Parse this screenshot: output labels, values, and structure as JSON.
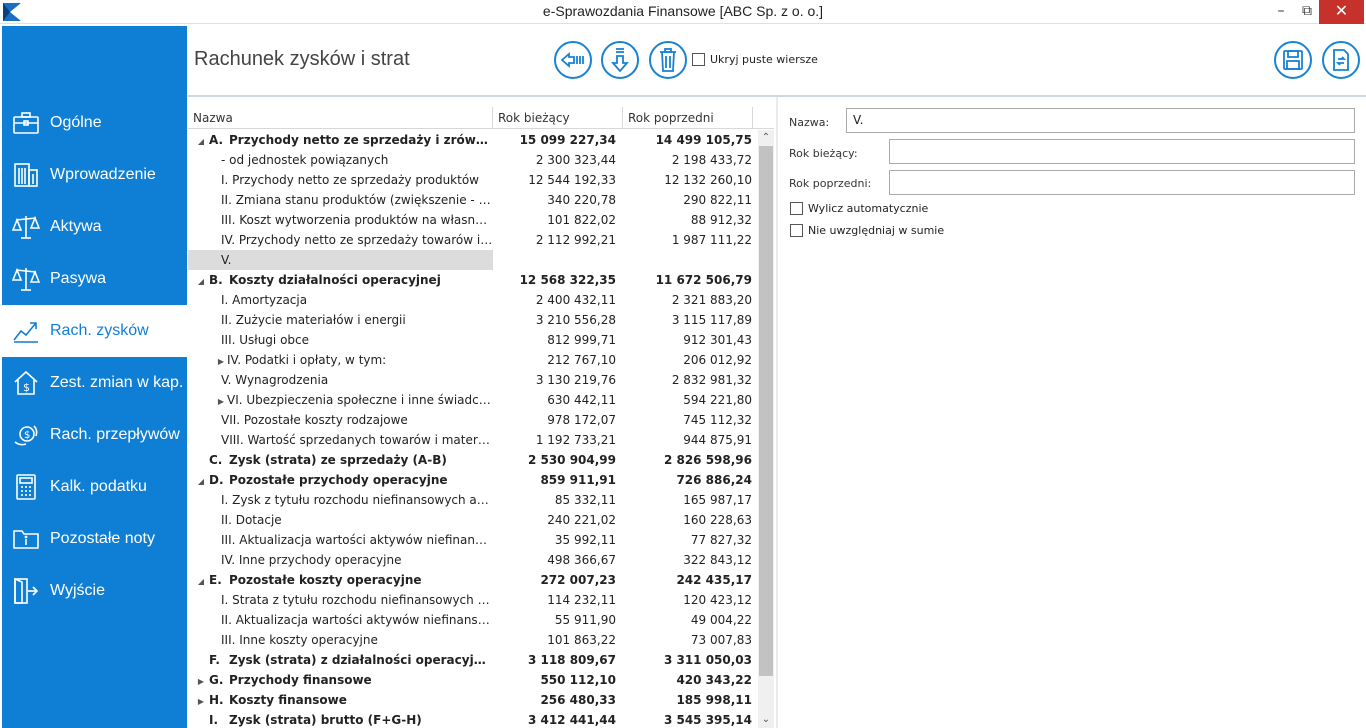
{
  "window": {
    "title": "e-Sprawozdania Finansowe  [ABC Sp. z o. o.]",
    "min": "–",
    "max": "⧉",
    "close": "✕"
  },
  "sidebar": {
    "items": [
      {
        "label": "Ogólne",
        "icon": "briefcase-icon"
      },
      {
        "label": "Wprowadzenie",
        "icon": "building-icon"
      },
      {
        "label": "Aktywa",
        "icon": "scales-icon"
      },
      {
        "label": "Pasywa",
        "icon": "scales-icon"
      },
      {
        "label": "Rach. zysków",
        "icon": "chart-trend-icon"
      },
      {
        "label": "Zest. zmian w kap.",
        "icon": "house-dollar-icon"
      },
      {
        "label": "Rach. przepływów",
        "icon": "cash-flow-icon"
      },
      {
        "label": "Kalk. podatku",
        "icon": "calculator-icon"
      },
      {
        "label": "Pozostałe noty",
        "icon": "folder-info-icon"
      },
      {
        "label": "Wyjście",
        "icon": "exit-door-icon"
      }
    ],
    "active_index": 4
  },
  "header": {
    "title": "Rachunek zysków i strat",
    "hide_empty_label": "Ukryj puste wiersze"
  },
  "grid": {
    "columns": [
      "Nazwa",
      "Rok bieżący",
      "Rok poprzedni"
    ],
    "rows": [
      {
        "indent": 0,
        "expander": "open",
        "letter": "A.",
        "name": "Przychody netto ze sprzedaży i zrównane z...",
        "cur": "15 099 227,34",
        "prev": "14 499 105,75",
        "bold": true
      },
      {
        "indent": 2,
        "expander": "",
        "letter": "",
        "name": "- od jednostek powiązanych",
        "cur": "2 300 323,44",
        "prev": "2 198 433,72",
        "bold": false
      },
      {
        "indent": 2,
        "expander": "",
        "letter": "",
        "name": "I. Przychody netto ze sprzedaży produktów",
        "cur": "12 544 192,33",
        "prev": "12 132 260,10",
        "bold": false
      },
      {
        "indent": 2,
        "expander": "",
        "letter": "",
        "name": "II. Zmiana stanu produktów (zwiększenie - war...",
        "cur": "340 220,78",
        "prev": "290 822,11",
        "bold": false
      },
      {
        "indent": 2,
        "expander": "",
        "letter": "",
        "name": "III. Koszt wytworzenia produktów na własne p...",
        "cur": "101 822,02",
        "prev": "88 912,32",
        "bold": false
      },
      {
        "indent": 2,
        "expander": "",
        "letter": "",
        "name": "IV. Przychody netto ze sprzedaży towarów i m...",
        "cur": "2 112 992,21",
        "prev": "1 987 111,22",
        "bold": false
      },
      {
        "indent": 2,
        "expander": "",
        "letter": "",
        "name": "V.",
        "cur": "",
        "prev": "",
        "bold": false,
        "selected": true
      },
      {
        "indent": 0,
        "expander": "open",
        "letter": "B.",
        "name": "Koszty działalności operacyjnej",
        "cur": "12 568 322,35",
        "prev": "11 672 506,79",
        "bold": true
      },
      {
        "indent": 2,
        "expander": "",
        "letter": "",
        "name": "I. Amortyzacja",
        "cur": "2 400 432,11",
        "prev": "2 321 883,20",
        "bold": false
      },
      {
        "indent": 2,
        "expander": "",
        "letter": "",
        "name": "II. Zużycie materiałów i energii",
        "cur": "3 210 556,28",
        "prev": "3 115 117,89",
        "bold": false
      },
      {
        "indent": 2,
        "expander": "",
        "letter": "",
        "name": "III. Usługi obce",
        "cur": "812 999,71",
        "prev": "912 301,43",
        "bold": false
      },
      {
        "indent": 1,
        "expander": "closed",
        "letter": "",
        "name": "IV. Podatki i opłaty, w tym:",
        "cur": "212 767,10",
        "prev": "206 012,92",
        "bold": false
      },
      {
        "indent": 2,
        "expander": "",
        "letter": "",
        "name": "V. Wynagrodzenia",
        "cur": "3 130 219,76",
        "prev": "2 832 981,32",
        "bold": false
      },
      {
        "indent": 1,
        "expander": "closed",
        "letter": "",
        "name": "VI. Ubezpieczenia społeczne i inne świadczeni...",
        "cur": "630 442,11",
        "prev": "594 221,80",
        "bold": false
      },
      {
        "indent": 2,
        "expander": "",
        "letter": "",
        "name": "VII. Pozostałe koszty rodzajowe",
        "cur": "978 172,07",
        "prev": "745 112,32",
        "bold": false
      },
      {
        "indent": 2,
        "expander": "",
        "letter": "",
        "name": "VIII. Wartość sprzedanych towarów i materiałów",
        "cur": "1 192 733,21",
        "prev": "944 875,91",
        "bold": false
      },
      {
        "indent": 0,
        "expander": "none",
        "letter": "C.",
        "name": "Zysk (strata) ze sprzedaży (A-B)",
        "cur": "2 530 904,99",
        "prev": "2 826 598,96",
        "bold": true
      },
      {
        "indent": 0,
        "expander": "open",
        "letter": "D.",
        "name": "Pozostałe przychody operacyjne",
        "cur": "859 911,91",
        "prev": "726 886,24",
        "bold": true
      },
      {
        "indent": 2,
        "expander": "",
        "letter": "",
        "name": "I. Zysk z tytułu rozchodu niefinansowych aktyw...",
        "cur": "85 332,11",
        "prev": "165 987,17",
        "bold": false
      },
      {
        "indent": 2,
        "expander": "",
        "letter": "",
        "name": "II. Dotacje",
        "cur": "240 221,02",
        "prev": "160 228,63",
        "bold": false
      },
      {
        "indent": 2,
        "expander": "",
        "letter": "",
        "name": "III. Aktualizacja wartości aktywów niefinansowy...",
        "cur": "35 992,11",
        "prev": "77 827,32",
        "bold": false
      },
      {
        "indent": 2,
        "expander": "",
        "letter": "",
        "name": "IV. Inne przychody operacyjne",
        "cur": "498 366,67",
        "prev": "322 843,12",
        "bold": false
      },
      {
        "indent": 0,
        "expander": "open",
        "letter": "E.",
        "name": "Pozostałe koszty operacyjne",
        "cur": "272 007,23",
        "prev": "242 435,17",
        "bold": true
      },
      {
        "indent": 2,
        "expander": "",
        "letter": "",
        "name": "I. Strata z tytułu rozchodu niefinansowych akty...",
        "cur": "114 232,11",
        "prev": "120 423,12",
        "bold": false
      },
      {
        "indent": 2,
        "expander": "",
        "letter": "",
        "name": "II. Aktualizacja wartości aktywów niefinansowych",
        "cur": "55 911,90",
        "prev": "49 004,22",
        "bold": false
      },
      {
        "indent": 2,
        "expander": "",
        "letter": "",
        "name": "III. Inne koszty operacyjne",
        "cur": "101 863,22",
        "prev": "73 007,83",
        "bold": false
      },
      {
        "indent": 0,
        "expander": "none",
        "letter": "F.",
        "name": "Zysk (strata) z działalności operacyjnej (C+...",
        "cur": "3 118 809,67",
        "prev": "3 311 050,03",
        "bold": true
      },
      {
        "indent": 0,
        "expander": "closed",
        "letter": "G.",
        "name": "Przychody finansowe",
        "cur": "550 112,10",
        "prev": "420 343,22",
        "bold": true
      },
      {
        "indent": 0,
        "expander": "closed",
        "letter": "H.",
        "name": "Koszty finansowe",
        "cur": "256 480,33",
        "prev": "185 998,11",
        "bold": true
      },
      {
        "indent": 0,
        "expander": "none",
        "letter": "I.",
        "name": "Zysk (strata) brutto (F+G-H)",
        "cur": "3 412 441,44",
        "prev": "3 545 395,14",
        "bold": true
      }
    ]
  },
  "detail": {
    "name_label": "Nazwa:",
    "name_value": "V.",
    "cur_label": "Rok bieżący:",
    "cur_value": "",
    "prev_label": "Rok poprzedni:",
    "prev_value": "",
    "auto_calc_label": "Wylicz automatycznie",
    "exclude_sum_label": "Nie uwzględniaj w sumie"
  }
}
